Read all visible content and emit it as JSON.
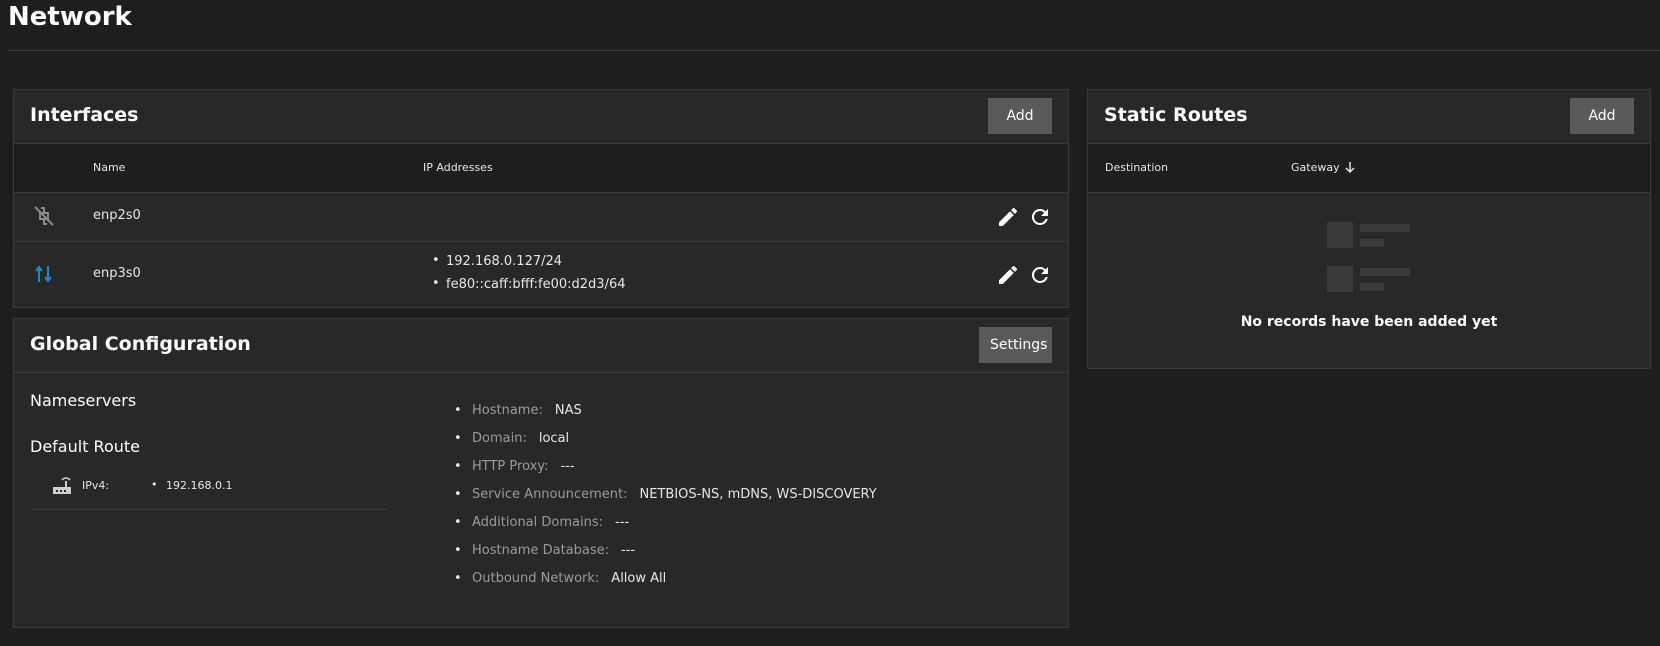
{
  "page": {
    "title": "Network"
  },
  "interfaces": {
    "title": "Interfaces",
    "add_label": "Add",
    "columns": {
      "name": "Name",
      "ip": "IP Addresses"
    },
    "rows": [
      {
        "name": "enp2s0",
        "icon": "link-off-icon",
        "ips": []
      },
      {
        "name": "enp3s0",
        "icon": "swap-arrows-icon",
        "ips": [
          "192.168.0.127/24",
          "fe80::caff:bfff:fe00:d2d3/64"
        ]
      }
    ]
  },
  "static_routes": {
    "title": "Static Routes",
    "add_label": "Add",
    "columns": {
      "destination": "Destination",
      "gateway": "Gateway"
    },
    "empty_text": "No records have been added yet"
  },
  "global_config": {
    "title": "Global Configuration",
    "settings_label": "Settings",
    "nameservers_label": "Nameservers",
    "default_route_label": "Default Route",
    "default_route": {
      "label": "IPv4:",
      "value": "192.168.0.1"
    },
    "items": [
      {
        "key": "Hostname:",
        "value": "NAS"
      },
      {
        "key": "Domain:",
        "value": "local"
      },
      {
        "key": "HTTP Proxy:",
        "value": "---"
      },
      {
        "key": "Service Announcement:",
        "value": "NETBIOS-NS, mDNS, WS-DISCOVERY"
      },
      {
        "key": "Additional Domains:",
        "value": "---"
      },
      {
        "key": "Hostname Database:",
        "value": "---"
      },
      {
        "key": "Outbound Network:",
        "value": "Allow All"
      }
    ]
  },
  "colors": {
    "background": "#1e1e1e",
    "card": "#282828",
    "button": "#5a5a5a",
    "accent_icon": "#1e88c8"
  }
}
